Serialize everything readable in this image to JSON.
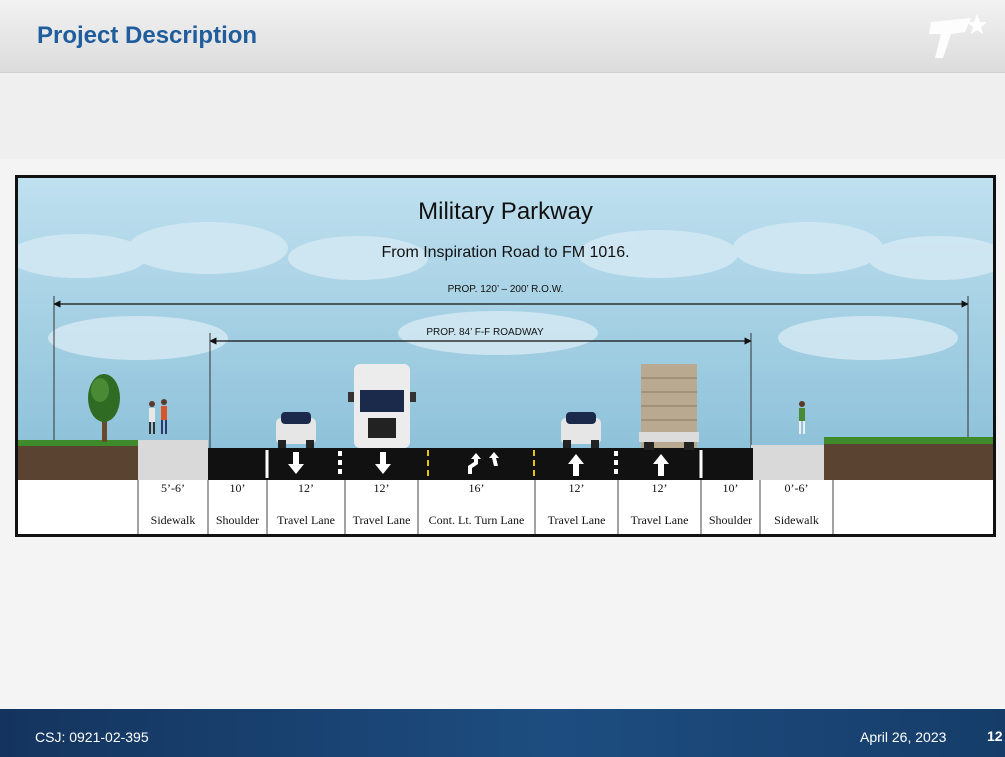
{
  "header": {
    "title": "Project Description"
  },
  "diagram": {
    "title": "Military Parkway",
    "subtitle": "From Inspiration Road to FM 1016.",
    "row_dimension": "PROP. 120’ – 200’ R.O.W.",
    "roadway_dimension": "PROP. 84’ F-F ROADWAY",
    "segments": [
      {
        "width": "5’-6’",
        "name": "Sidewalk"
      },
      {
        "width": "10’",
        "name": "Shoulder"
      },
      {
        "width": "12’",
        "name": "Travel Lane"
      },
      {
        "width": "12’",
        "name": "Travel Lane"
      },
      {
        "width": "16’",
        "name": "Cont. Lt. Turn Lane"
      },
      {
        "width": "12’",
        "name": "Travel Lane"
      },
      {
        "width": "12’",
        "name": "Travel Lane"
      },
      {
        "width": "10’",
        "name": "Shoulder"
      },
      {
        "width": "0’-6’",
        "name": "Sidewalk"
      }
    ]
  },
  "footer": {
    "csj": "CSJ: 0921-02-395",
    "date": "April 26, 2023",
    "page": "12"
  },
  "colors": {
    "title_blue": "#1f5d9c",
    "sky": "#aed4e6",
    "grass": "#3f8a2a",
    "asphalt": "#111111",
    "footer": "#1d4d80"
  }
}
